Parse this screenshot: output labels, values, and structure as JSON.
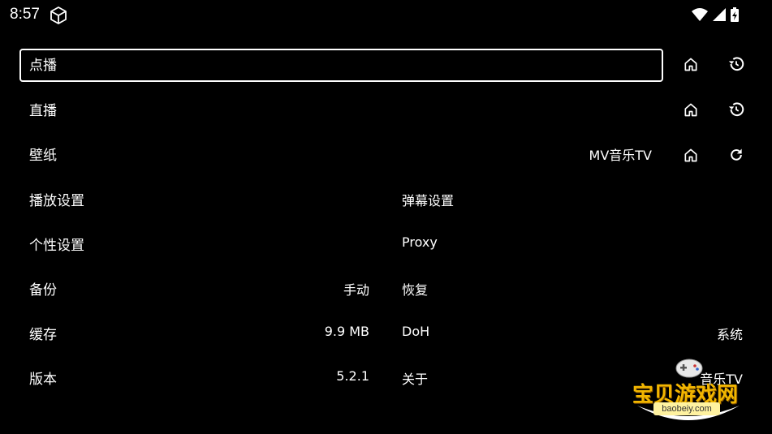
{
  "status": {
    "time": "8:57"
  },
  "rows": {
    "vod": {
      "label": "点播"
    },
    "live": {
      "label": "直播"
    },
    "wallpaper": {
      "label": "壁纸",
      "value": "MV音乐TV"
    },
    "playback": {
      "label": "播放设置",
      "right_label": "弹幕设置"
    },
    "personal": {
      "label": "个性设置",
      "right_label": "Proxy"
    },
    "backup": {
      "label": "备份",
      "value": "手动",
      "right_label": "恢复"
    },
    "cache": {
      "label": "缓存",
      "value": "9.9 MB",
      "right_label": "DoH",
      "right_value": "系统"
    },
    "version": {
      "label": "版本",
      "value": "5.2.1",
      "right_label": "关于",
      "right_value": "音乐TV"
    }
  },
  "watermark": {
    "text": "宝贝游戏网",
    "url": "baobeiy.com"
  },
  "icons": {
    "home": "home-icon",
    "history": "history-icon",
    "refresh": "refresh-icon"
  }
}
